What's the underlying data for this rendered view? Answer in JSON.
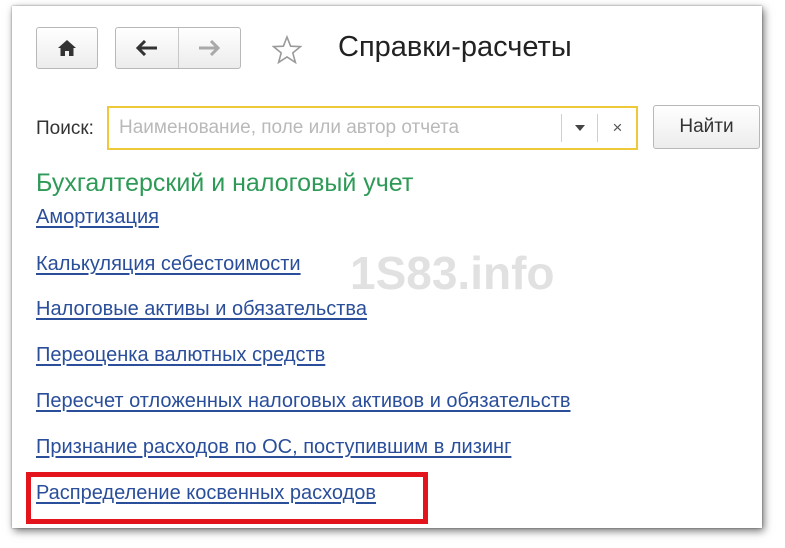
{
  "header": {
    "home_icon": "home-icon",
    "back_icon": "arrow-left-icon",
    "forward_icon": "arrow-right-icon",
    "favorite_icon": "star-icon",
    "title": "Справки-расчеты"
  },
  "search": {
    "label": "Поиск:",
    "placeholder": "Наименование, поле или автор отчета",
    "value": "",
    "dropdown_icon": "caret-down-icon",
    "clear_label": "×",
    "find_label": "Найти",
    "border_color": "#f0c93a"
  },
  "section": {
    "heading": "Бухгалтерский и налоговый учет",
    "heading_color": "#2e9a57",
    "link_color": "#2a4e9a",
    "reports": [
      "Амортизация",
      "Калькуляция себестоимости",
      "Налоговые активы и обязательства",
      "Переоценка валютных средств",
      "Пересчет отложенных налоговых активов и обязательств",
      "Признание расходов по ОС, поступившим в лизинг",
      "Распределение косвенных расходов"
    ]
  },
  "highlight": {
    "target": "Распределение косвенных расходов",
    "color": "#e3141b"
  },
  "watermark": "1S83.info"
}
